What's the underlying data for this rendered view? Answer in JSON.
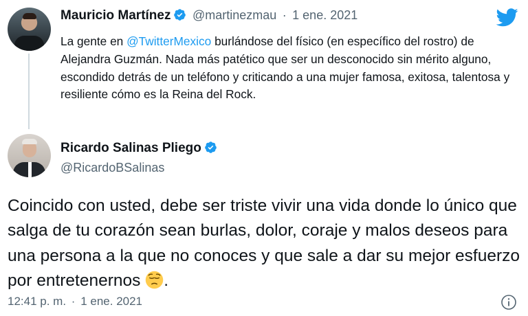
{
  "tweet_parent": {
    "author_name": "Mauricio Martínez",
    "handle": "@martinezmau",
    "separator": "·",
    "date": "1 ene. 2021",
    "text_before": "La gente en ",
    "mention": "@TwitterMexico",
    "text_after": " burlándose del físico (en específico del rostro) de Alejandra Guzmán. Nada más patético que ser un desconocido sin mérito alguno, escondido detrás de un teléfono y criticando a una mujer famosa, exitosa, talentosa y resiliente cómo es la Reina del Rock."
  },
  "tweet_main": {
    "author_name": "Ricardo Salinas Pliego",
    "handle": "@RicardoBSalinas",
    "text": "Coincido con usted, debe ser triste vivir una vida donde lo único que salga de tu corazón sean burlas, dolor, coraje y malos deseos para una persona a la que no conoces y que sale a dar su mejor esfuerzo por entretenernos",
    "text_end": ".",
    "emoji": "pensive-face",
    "time": "12:41 p. m.",
    "separator": "·",
    "date": "1 ene. 2021"
  },
  "colors": {
    "accent": "#1d9bf0",
    "text": "#0f1419",
    "muted": "#536471",
    "thread_line": "#cfd9de"
  },
  "icons": [
    "twitter-bird-icon",
    "verified-badge-icon",
    "info-icon"
  ]
}
